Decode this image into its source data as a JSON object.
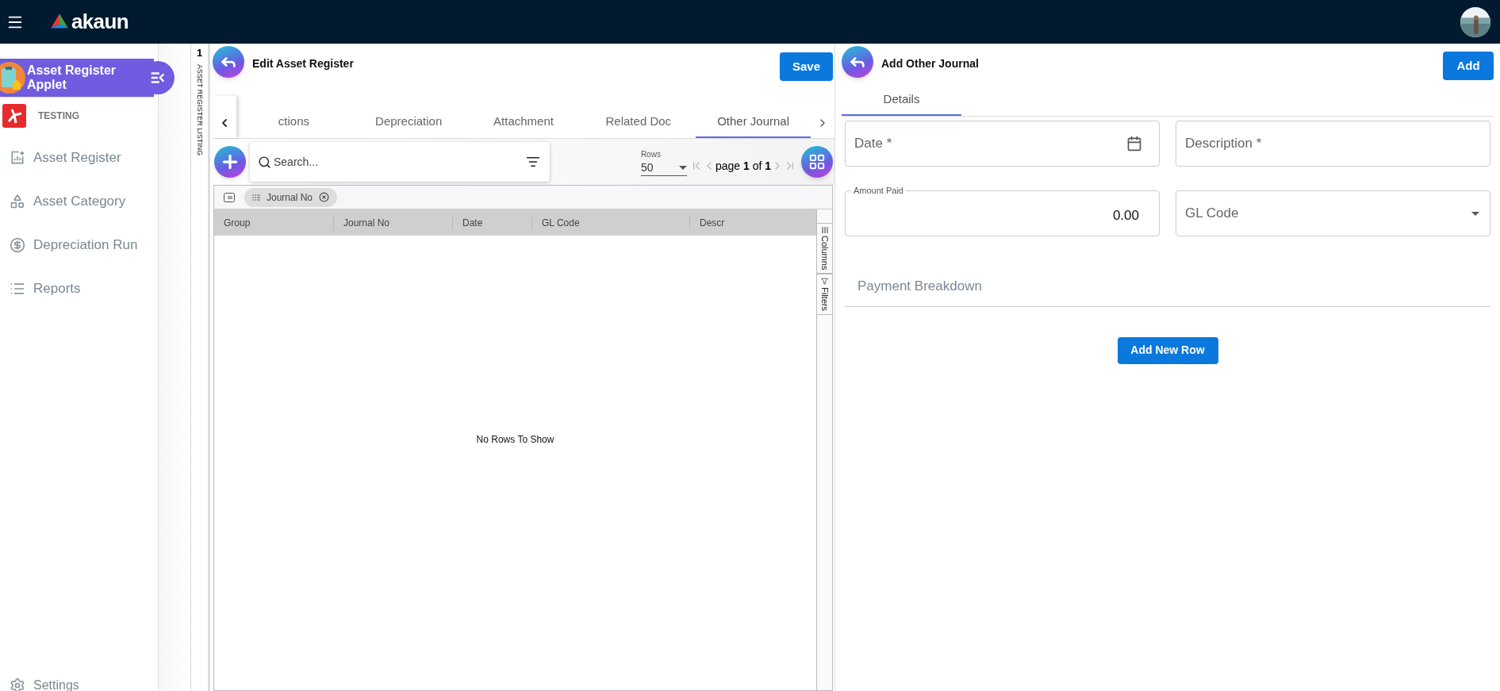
{
  "topbar": {
    "logo_text": "akaun"
  },
  "sidebar": {
    "applet_title": "Asset Register Applet",
    "org": "TESTING",
    "items": [
      {
        "label": "Asset Register"
      },
      {
        "label": "Asset Category"
      },
      {
        "label": "Depreciation Run"
      },
      {
        "label": "Reports"
      }
    ],
    "footer_item": {
      "label": "Settings"
    }
  },
  "listing_tab": {
    "count": "1",
    "label": "ASSET REGISTER LISTING"
  },
  "edit_panel": {
    "title": "Edit Asset Register",
    "save_button": "Save",
    "tabs": [
      {
        "label": "ctions",
        "selected": false
      },
      {
        "label": "Depreciation",
        "selected": false
      },
      {
        "label": "Attachment",
        "selected": false
      },
      {
        "label": "Related Doc",
        "selected": false
      },
      {
        "label": "Other Journal",
        "selected": true
      }
    ],
    "search": {
      "placeholder": "Search..."
    },
    "pagination": {
      "rows_label": "Rows",
      "rows_value": "50",
      "page_word": "page",
      "page": "1",
      "of_word": "of",
      "total": "1"
    },
    "group_chip": "Journal No",
    "table": {
      "columns": [
        "Group",
        "Journal No",
        "Date",
        "GL Code",
        "Descr"
      ],
      "empty_text": "No Rows To Show"
    },
    "side_buttons": [
      "Columns",
      "Filters"
    ]
  },
  "journal_panel": {
    "title": "Add Other Journal",
    "add_button": "Add",
    "tabs": [
      {
        "label": "Details",
        "selected": true
      }
    ],
    "date": {
      "placeholder": "Date *"
    },
    "description": {
      "placeholder": "Description *"
    },
    "amount": {
      "label": "Amount Paid",
      "value": "0.00"
    },
    "gl_code": {
      "placeholder": "GL Code"
    },
    "section_title": "Payment Breakdown",
    "add_row_button": "Add New Row"
  }
}
